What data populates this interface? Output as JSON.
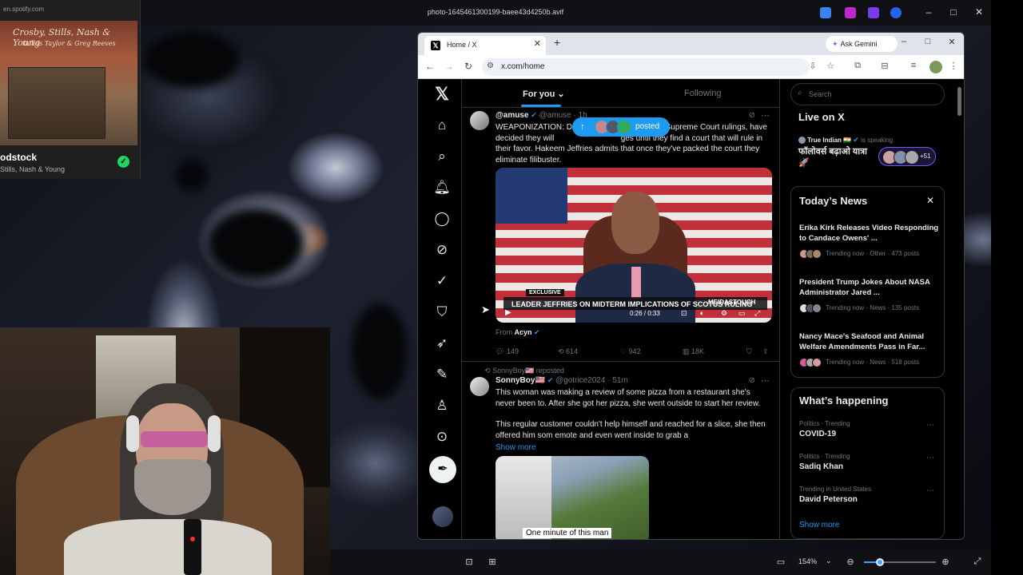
{
  "viewer": {
    "title": "photo-1645461300199-baee43d4250b.avif",
    "zoom": "154%",
    "zoom_level_fraction": 0.22
  },
  "spotify": {
    "url": "en.spotify.com",
    "album_text": "Crosby, Stills, Nash & Young",
    "album_sub": "Dallas Taylor & Greg Reeves",
    "song": "odstock",
    "artist": "Stills, Nash & Young"
  },
  "browser": {
    "tab_title": "Home / X",
    "gemini_label": "Ask Gemini",
    "url": "x.com/home"
  },
  "x": {
    "tabs": {
      "for_you": "For you",
      "following": "Following"
    },
    "toast_label": "posted",
    "tweet1": {
      "name": "@amuse",
      "handle": "@amuse",
      "time": "· 1h",
      "text": "WEAPONIZATION: De                                        Supreme Court rulings, have decided they will                              ges until they find a court that will rule in their favor. Hakeem Jeffries admits that once they've packed the court they eliminate filibuster.",
      "video": {
        "exclusive": "EXCLUSIVE",
        "headline": "LEADER JEFFRIES ON MIDTERM IMPLICATIONS OF SCOTUS RULING",
        "brand": "MEIDASTOUCH",
        "time": "0:26 / 0:33"
      },
      "from_label": "From",
      "from_name": "Acyn",
      "replies": "149",
      "reposts": "614",
      "likes": "942",
      "views": "18K"
    },
    "tweet2": {
      "repost_label": "SonnyBoy🇺🇸 reposted",
      "name": "SonnyBoy🇺🇸",
      "handle": "@gotrice2024",
      "time": "· 51m",
      "text1": "This woman was making a review of some pizza from a restaurant she's never been to. After she got her pizza, she went outside to start her review.",
      "text2": "This regular customer couldn't help himself and reached for a slice, she then offered him som emote and even went inside to grab a",
      "show_more": "Show more",
      "caption": "One minute of this man"
    },
    "sidebar": {
      "search_placeholder": "Search",
      "live": {
        "heading": "Live on X",
        "host": "True Indian 🇮🇳",
        "speaking": "is speaking",
        "title": "फॉलोवर्स बढ़ाओ यात्रा 🚀",
        "count": "+51"
      },
      "news": {
        "heading": "Today’s News",
        "items": [
          {
            "title": "Erika Kirk Releases Video Responding to Candace Owens' ...",
            "meta": "Trending now · Other · 473 posts"
          },
          {
            "title": "President Trump Jokes About NASA Administrator Jared ...",
            "meta": "Trending now · News · 135 posts"
          },
          {
            "title": "Nancy Mace's Seafood and Animal Welfare Amendments Pass in Far...",
            "meta": "Trending now · News · 518 posts"
          }
        ]
      },
      "happening": {
        "heading": "What’s happening",
        "items": [
          {
            "category": "Politics · Trending",
            "name": "COVID-19"
          },
          {
            "category": "Politics · Trending",
            "name": "Sadiq Khan"
          },
          {
            "category": "Trending in United States",
            "name": "David Peterson"
          }
        ],
        "show_more": "Show more"
      }
    }
  },
  "colors": {
    "x_blue": "#1d9bf0",
    "spotify_green": "#1ed760",
    "live_purple": "#7856ff"
  },
  "icons": [
    "x-logo-icon",
    "home-icon",
    "search-icon",
    "bell-icon",
    "messages-icon",
    "grok-icon",
    "communities-icon",
    "bookmark-icon",
    "rocket-icon",
    "compose-icon",
    "profile-icon",
    "more-icon"
  ]
}
